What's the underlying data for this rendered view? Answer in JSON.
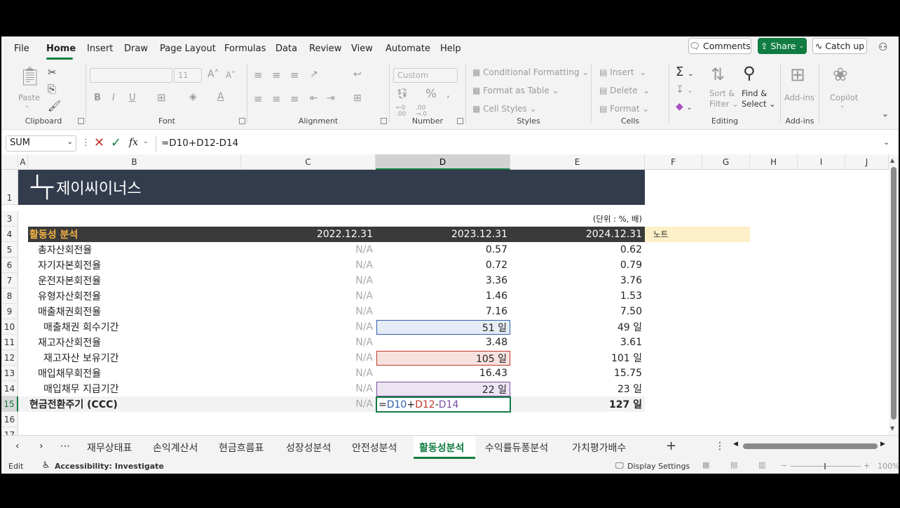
{
  "menu": {
    "items": [
      "File",
      "Home",
      "Insert",
      "Draw",
      "Page Layout",
      "Formulas",
      "Data",
      "Review",
      "View",
      "Automate",
      "Help"
    ],
    "active": "Home",
    "comments_label": "Comments",
    "share_label": "Share",
    "catchup_label": "Catch up"
  },
  "ribbon": {
    "clipboard": {
      "label": "Clipboard",
      "paste": "Paste"
    },
    "font": {
      "label": "Font",
      "size": "11",
      "bold": "B",
      "italic": "I",
      "underline": "U"
    },
    "alignment": {
      "label": "Alignment"
    },
    "number": {
      "label": "Number",
      "format": "Custom"
    },
    "styles": {
      "label": "Styles",
      "conditional": "Conditional Formatting",
      "format_table": "Format as Table",
      "cell_styles": "Cell Styles"
    },
    "cells": {
      "label": "Cells",
      "insert": "Insert",
      "delete": "Delete",
      "format": "Format"
    },
    "editing": {
      "label": "Editing",
      "sort_filter_1": "Sort &",
      "sort_filter_2": "Filter",
      "find_select_1": "Find &",
      "find_select_2": "Select"
    },
    "addins": {
      "label": "Add-ins",
      "button": "Add-ins"
    },
    "copilot": {
      "label": "Copilot"
    }
  },
  "formula_bar": {
    "name_box": "SUM",
    "fx": "fx",
    "formula": "=D10+D12-D14"
  },
  "columns": [
    "A",
    "B",
    "C",
    "D",
    "E",
    "F",
    "G",
    "H",
    "I",
    "J"
  ],
  "selected_column": "D",
  "banner": {
    "brand": "제이씨이너스"
  },
  "unit_note": "(단위 : %, 배)",
  "header": {
    "title": "활동성 분석",
    "y1": "2022.12.31",
    "y2": "2023.12.31",
    "y3": "2024.12.31",
    "note": "노트"
  },
  "rows": [
    {
      "num": "5",
      "label": "총자산회전율",
      "c": "N/A",
      "d": "0.57",
      "e": "0.62",
      "indent": false
    },
    {
      "num": "6",
      "label": "자기자본회전율",
      "c": "N/A",
      "d": "0.72",
      "e": "0.79",
      "indent": false
    },
    {
      "num": "7",
      "label": "운전자본회전율",
      "c": "N/A",
      "d": "3.36",
      "e": "3.76",
      "indent": false
    },
    {
      "num": "8",
      "label": "유형자산회전율",
      "c": "N/A",
      "d": "1.46",
      "e": "1.53",
      "indent": false
    },
    {
      "num": "9",
      "label": "매출채권회전율",
      "c": "N/A",
      "d": "7.16",
      "e": "7.50",
      "indent": false
    },
    {
      "num": "10",
      "label": "매출채권 회수기간",
      "c": "N/A",
      "d": "51 일",
      "e": "49 일",
      "indent": true
    },
    {
      "num": "11",
      "label": "재고자산회전율",
      "c": "N/A",
      "d": "3.48",
      "e": "3.61",
      "indent": false
    },
    {
      "num": "12",
      "label": "재고자산 보유기간",
      "c": "N/A",
      "d": "105 일",
      "e": "101 일",
      "indent": true
    },
    {
      "num": "13",
      "label": "매입채무회전율",
      "c": "N/A",
      "d": "16.43",
      "e": "15.75",
      "indent": false
    },
    {
      "num": "14",
      "label": "매입채무 지급기간",
      "c": "N/A",
      "d": "22 일",
      "e": "23 일",
      "indent": true
    }
  ],
  "ccc_row": {
    "num": "15",
    "label": "현금전환주기 (CCC)",
    "c": "N/A",
    "formula_parts": [
      "=",
      "D10",
      "+",
      "D12",
      "-",
      "D14"
    ],
    "e": "127 일"
  },
  "row_numbers_extra": [
    "1",
    "3",
    "4",
    "16",
    "17"
  ],
  "sheet_tabs": [
    "재무상태표",
    "손익계산서",
    "현금흐름표",
    "성장성분석",
    "안전성분석",
    "활동성분석",
    "수익률듀퐁분석",
    "가치평가배수"
  ],
  "active_tab": "활동성분석",
  "status": {
    "mode": "Edit",
    "accessibility": "Accessibility: Investigate",
    "display_settings": "Display Settings",
    "zoom": "100%"
  },
  "colors": {
    "accent": "#107c41",
    "banner_bg": "#323c4d",
    "header_bg": "#3a3a3a",
    "header_title": "#f5b342",
    "note_bg": "#fdf0c8",
    "ref_blue": "#2e5fa8",
    "ref_red": "#c0392b",
    "ref_purple": "#7b4fa0"
  }
}
